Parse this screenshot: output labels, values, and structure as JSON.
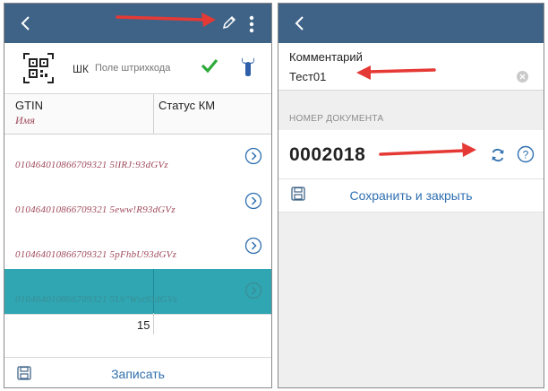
{
  "screen_left": {
    "scan": {
      "label": "ШК",
      "placeholder": "Поле штрихкода"
    },
    "table": {
      "headers": {
        "gtin": "GTIN",
        "name": "Имя",
        "status": "Статус КМ"
      },
      "rows": [
        {
          "code": "010464010866709321 5lIRJ:93dGVz"
        },
        {
          "code": "010464010866709321 5eww!R93dGVz"
        },
        {
          "code": "010464010866709321 5pFhbU93dGVz"
        },
        {
          "code": "010464010866709321 5Ut\"Wst93dGVz"
        }
      ],
      "total": "15"
    },
    "bottom": {
      "save_label": "Записать"
    }
  },
  "screen_right": {
    "comment": {
      "label": "Комментарий",
      "value": "Тест01"
    },
    "doc_section": {
      "label": "НОМЕР ДОКУМЕНТА",
      "number": "0002018"
    },
    "save_close_label": "Сохранить и закрыть"
  },
  "colors": {
    "appbar": "#3f6387",
    "selected_row": "#2fa6b2",
    "annotation_arrow": "#e53935",
    "link": "#2f6fb0",
    "accent_green": "#2eaa3a"
  }
}
